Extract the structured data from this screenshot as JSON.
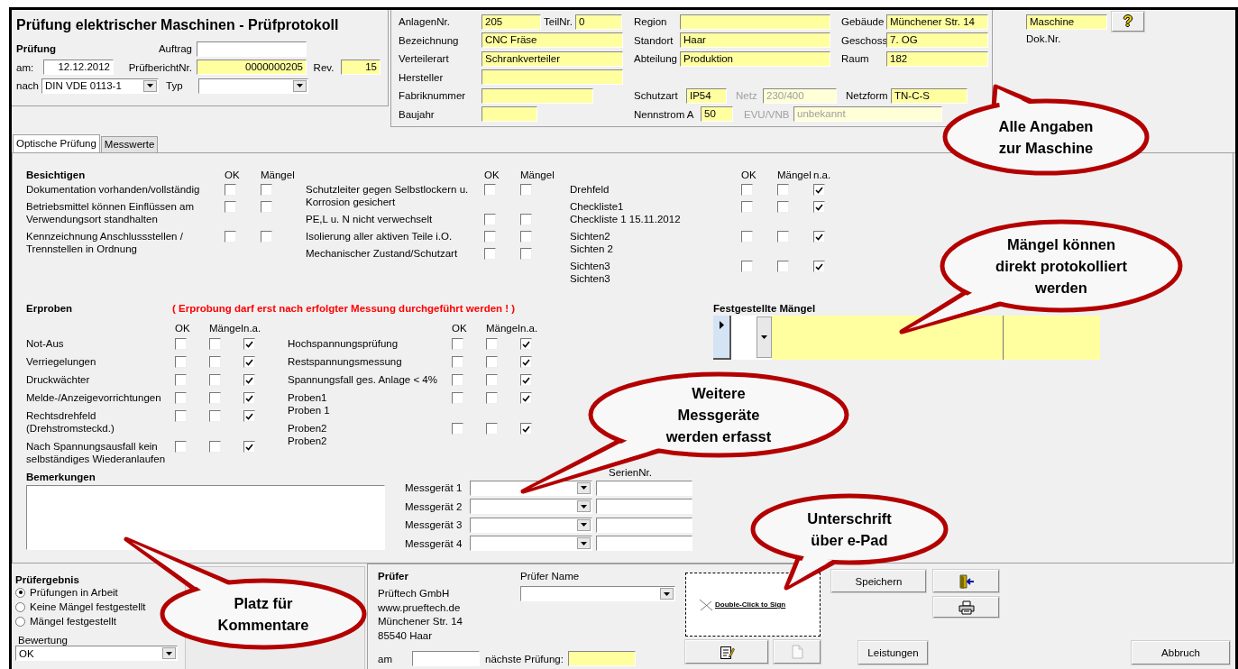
{
  "title": "Prüfung elektrischer Maschinen - Prüfprotokoll",
  "inspection": {
    "heading": "Prüfung",
    "order_label": "Auftrag",
    "date_label": "am:",
    "date_value": "12.12.2012",
    "report_label": "PrüfberichtNr.",
    "report_value": "0000000205",
    "rev_label": "Rev.",
    "rev_value": "15",
    "standard_label": "nach",
    "standard_value": "DIN VDE 0113-1",
    "type_label": "Typ"
  },
  "machine": {
    "main": [
      {
        "label": "AnlagenNr.",
        "value": "205"
      },
      {
        "label": "Bezeichnung",
        "value": "CNC Fräse"
      },
      {
        "label": "Verteilerart",
        "value": "Schrankverteiler"
      },
      {
        "label": "Hersteller"
      },
      {
        "label": "Fabriknummer"
      },
      {
        "label": "Baujahr"
      }
    ],
    "part": {
      "label": "TeilNr.",
      "value": "0"
    },
    "location": [
      {
        "label": "Region"
      },
      {
        "label": "Standort",
        "value": "Haar"
      },
      {
        "label": "Abteilung",
        "value": "Produktion"
      }
    ],
    "building": [
      {
        "label": "Gebäude",
        "value": "Münchener Str. 14"
      },
      {
        "label": "Geschoss",
        "value": "7. OG"
      },
      {
        "label": "Raum",
        "value": "182"
      }
    ],
    "electrical": [
      {
        "label": "Schutzart",
        "value": "IP54",
        "disabled": false
      },
      {
        "label": "Netz",
        "value": "230/400",
        "disabled": true
      },
      {
        "label": "Netzform",
        "value": "TN-C-S",
        "disabled": false
      },
      {
        "label": "Nennstrom A",
        "value": "50",
        "disabled": false
      },
      {
        "label": "EVU/VNB",
        "value": "unbekannt",
        "disabled": true
      }
    ]
  },
  "document": {
    "category_value": "Maschine",
    "help_label": "?",
    "doc_label": "Dok.Nr."
  },
  "tabs": [
    {
      "label": "Optische Prüfung",
      "selected": true
    },
    {
      "label": "Messwerte",
      "selected": false
    }
  ],
  "visual_check": {
    "heading": "Besichtigen",
    "groups": [
      {
        "columns": [
          "OK",
          "Mängel"
        ],
        "items": [
          {
            "label": "Dokumentation vorhanden/vollständig",
            "checked": [
              false,
              false
            ]
          },
          {
            "label": "Betriebsmittel können Einflüssen am\nVerwendungsort standhalten",
            "checked": [
              false,
              false
            ]
          },
          {
            "label": "Kennzeichnung Anschlussstellen /\nTrennstellen in Ordnung",
            "checked": [
              false,
              false
            ]
          }
        ]
      },
      {
        "columns": [
          "OK",
          "Mängel"
        ],
        "items": [
          {
            "label": "Schutzleiter gegen Selbstlockern u.\nKorrosion gesichert",
            "checked": [
              false,
              false
            ]
          },
          {
            "label": "PE,L u. N nicht verwechselt",
            "checked": [
              false,
              false
            ]
          },
          {
            "label": "Isolierung aller aktiven Teile i.O.",
            "checked": [
              false,
              false
            ]
          },
          {
            "label": "Mechanischer Zustand/Schutzart",
            "checked": [
              false,
              false
            ]
          }
        ]
      },
      {
        "columns": [
          "OK",
          "Mängel",
          "n.a."
        ],
        "items": [
          {
            "label": "Drehfeld",
            "checked": [
              false,
              false,
              true
            ]
          },
          {
            "label": "Checkliste1\nCheckliste 1 15.11.2012",
            "checked": [
              false,
              false,
              true
            ]
          },
          {
            "label": "Sichten2\nSichten 2",
            "checked": [
              false,
              false,
              true
            ]
          },
          {
            "label": "Sichten3\nSichten3",
            "checked": [
              false,
              false,
              true
            ]
          }
        ]
      }
    ]
  },
  "function_test": {
    "heading": "Erproben",
    "warning": "( Erprobung darf erst nach erfolgter Messung durchgeführt werden ! )",
    "groups": [
      {
        "columns": [
          "OK",
          "Mängel",
          "n.a."
        ],
        "items": [
          {
            "label": "Not-Aus",
            "checked": [
              false,
              false,
              true
            ]
          },
          {
            "label": "Verriegelungen",
            "checked": [
              false,
              false,
              true
            ]
          },
          {
            "label": "Druckwächter",
            "checked": [
              false,
              false,
              true
            ]
          },
          {
            "label": "Melde-/Anzeigevorrichtungen",
            "checked": [
              false,
              false,
              true
            ]
          },
          {
            "label": "Rechtsdrehfeld\n(Drehstromsteckd.)",
            "checked": [
              false,
              false,
              true
            ]
          },
          {
            "label": "Nach Spannungsausfall kein\nselbständiges Wiederanlaufen",
            "checked": [
              false,
              false,
              true
            ]
          }
        ]
      },
      {
        "columns": [
          "OK",
          "Mängel",
          "n.a."
        ],
        "items": [
          {
            "label": "Hochspannungsprüfung",
            "checked": [
              false,
              false,
              true
            ]
          },
          {
            "label": "Restspannungsmessung",
            "checked": [
              false,
              false,
              true
            ]
          },
          {
            "label": "Spannungsfall ges. Anlage < 4%",
            "checked": [
              false,
              false,
              true
            ]
          },
          {
            "label": "Proben1\nProben 1",
            "checked": [
              false,
              false,
              true
            ]
          },
          {
            "label": "Proben2\nProben2",
            "checked": [
              false,
              false,
              true
            ]
          }
        ]
      }
    ]
  },
  "defects": {
    "heading": "Festgestellte Mängel"
  },
  "remarks": {
    "heading": "Bemerkungen"
  },
  "instruments": {
    "serial_label": "SerienNr.",
    "rows": [
      {
        "label": "Messgerät 1"
      },
      {
        "label": "Messgerät 2"
      },
      {
        "label": "Messgerät 3"
      },
      {
        "label": "Messgerät 4"
      }
    ]
  },
  "result": {
    "heading": "Prüfergebnis",
    "options": [
      {
        "label": "Prüfungen in Arbeit",
        "selected": true
      },
      {
        "label": "Keine Mängel festgestellt",
        "selected": false
      },
      {
        "label": "Mängel festgestellt",
        "selected": false
      }
    ],
    "rating_label": "Bewertung",
    "rating_value": "OK"
  },
  "inspector": {
    "heading": "Prüfer",
    "name_label": "Prüfer Name",
    "address": [
      "Prüftech GmbH",
      "www.prueftech.de",
      "Münchener Str. 14",
      "85540 Haar"
    ],
    "date_label": "am",
    "next_label": "nächste Prüfung:",
    "signature_hint": "Double-Click to Sign"
  },
  "buttons": {
    "save": "Speichern",
    "services": "Leistungen",
    "cancel": "Abbruch"
  },
  "callouts": [
    {
      "lines": [
        "Alle Angaben",
        "zur Maschine"
      ]
    },
    {
      "lines": [
        "Mängel können",
        "direkt protokolliert",
        "werden"
      ]
    },
    {
      "lines": [
        "Weitere",
        "Messgeräte",
        "werden erfasst"
      ]
    },
    {
      "lines": [
        "Unterschrift",
        "über e-Pad"
      ]
    },
    {
      "lines": [
        "Platz für",
        "Kommentare"
      ]
    }
  ]
}
